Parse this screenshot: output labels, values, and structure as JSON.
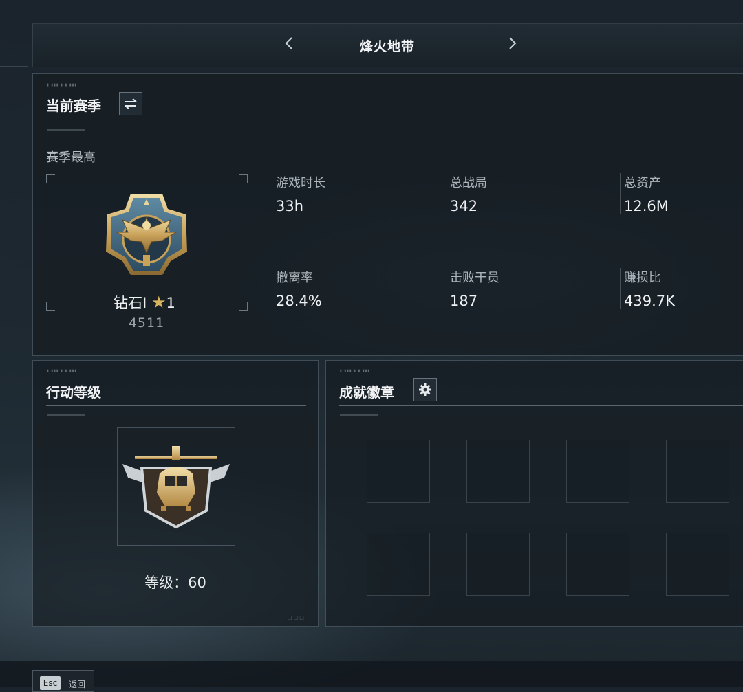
{
  "header": {
    "title": "烽火地带",
    "prev_icon": "chevron-left-icon",
    "next_icon": "chevron-right-icon"
  },
  "season": {
    "title": "当前赛季",
    "switch_icon": "swap-arrows-icon",
    "subheading": "赛季最高",
    "rank": {
      "name": "钻石Ⅰ",
      "stars": "1",
      "score": "4511"
    },
    "stats": [
      {
        "label": "游戏时长",
        "value": "33h"
      },
      {
        "label": "总战局",
        "value": "342"
      },
      {
        "label": "总资产",
        "value": "12.6M"
      },
      {
        "label": "撤离率",
        "value": "28.4%"
      },
      {
        "label": "击败干员",
        "value": "187"
      },
      {
        "label": "赚损比",
        "value": "439.7K"
      }
    ]
  },
  "operation": {
    "title": "行动等级",
    "level_text": "等级：60"
  },
  "achievements": {
    "title": "成就徽章",
    "settings_icon": "gear-icon",
    "slots": 8
  },
  "footer": {
    "esc_key": "Esc",
    "back_label": "返回"
  },
  "colors": {
    "accent_gold": "#d8b45a",
    "panel_border": "#8ca0af"
  }
}
